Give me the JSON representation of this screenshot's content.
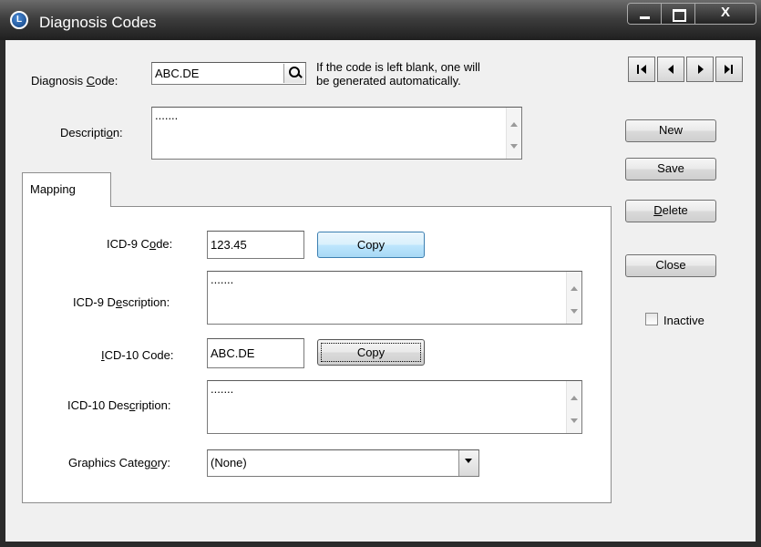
{
  "window": {
    "title": "Diagnosis Codes",
    "app_icon_glyph": "L",
    "controls": {
      "close_glyph": "X"
    }
  },
  "header": {
    "diagnosis_code": {
      "label_pre": "Diagnosis ",
      "label_key": "C",
      "label_post": "ode:",
      "value": "ABC.DE"
    },
    "hint_line1": "If the code is left blank, one will",
    "hint_line2": "be generated automatically.",
    "description": {
      "label_pre": "Descripti",
      "label_key": "o",
      "label_post": "n:",
      "value": "......."
    }
  },
  "tabs": [
    {
      "label": "Mapping",
      "selected": true
    }
  ],
  "mapping": {
    "icd9_code": {
      "label_pre": "ICD-9 C",
      "label_key": "o",
      "label_post": "de:",
      "value": "123.45"
    },
    "icd9_copy": "Copy",
    "icd9_description": {
      "label_pre": "ICD-9 D",
      "label_key": "e",
      "label_post": "scription:",
      "value": "......."
    },
    "icd10_code": {
      "label_pre": "",
      "label_key": "I",
      "label_post": "CD-10 Code:",
      "value": "ABC.DE"
    },
    "icd10_copy": "Copy",
    "icd10_description": {
      "label_pre": "ICD-10 Des",
      "label_key": "c",
      "label_post": "ription:",
      "value": "......."
    },
    "graphics_category": {
      "label_pre": "Graphics Categ",
      "label_key": "o",
      "label_post": "ry:",
      "value": "(None)"
    }
  },
  "side": {
    "nav": [
      "first-record-icon",
      "previous-record-icon",
      "next-record-icon",
      "last-record-icon"
    ],
    "new_label": "New",
    "save_label": "Save",
    "delete": {
      "pre": "",
      "key": "D",
      "post": "elete"
    },
    "close_label": "Close",
    "inactive": {
      "label": "Inactive",
      "checked": false
    }
  }
}
